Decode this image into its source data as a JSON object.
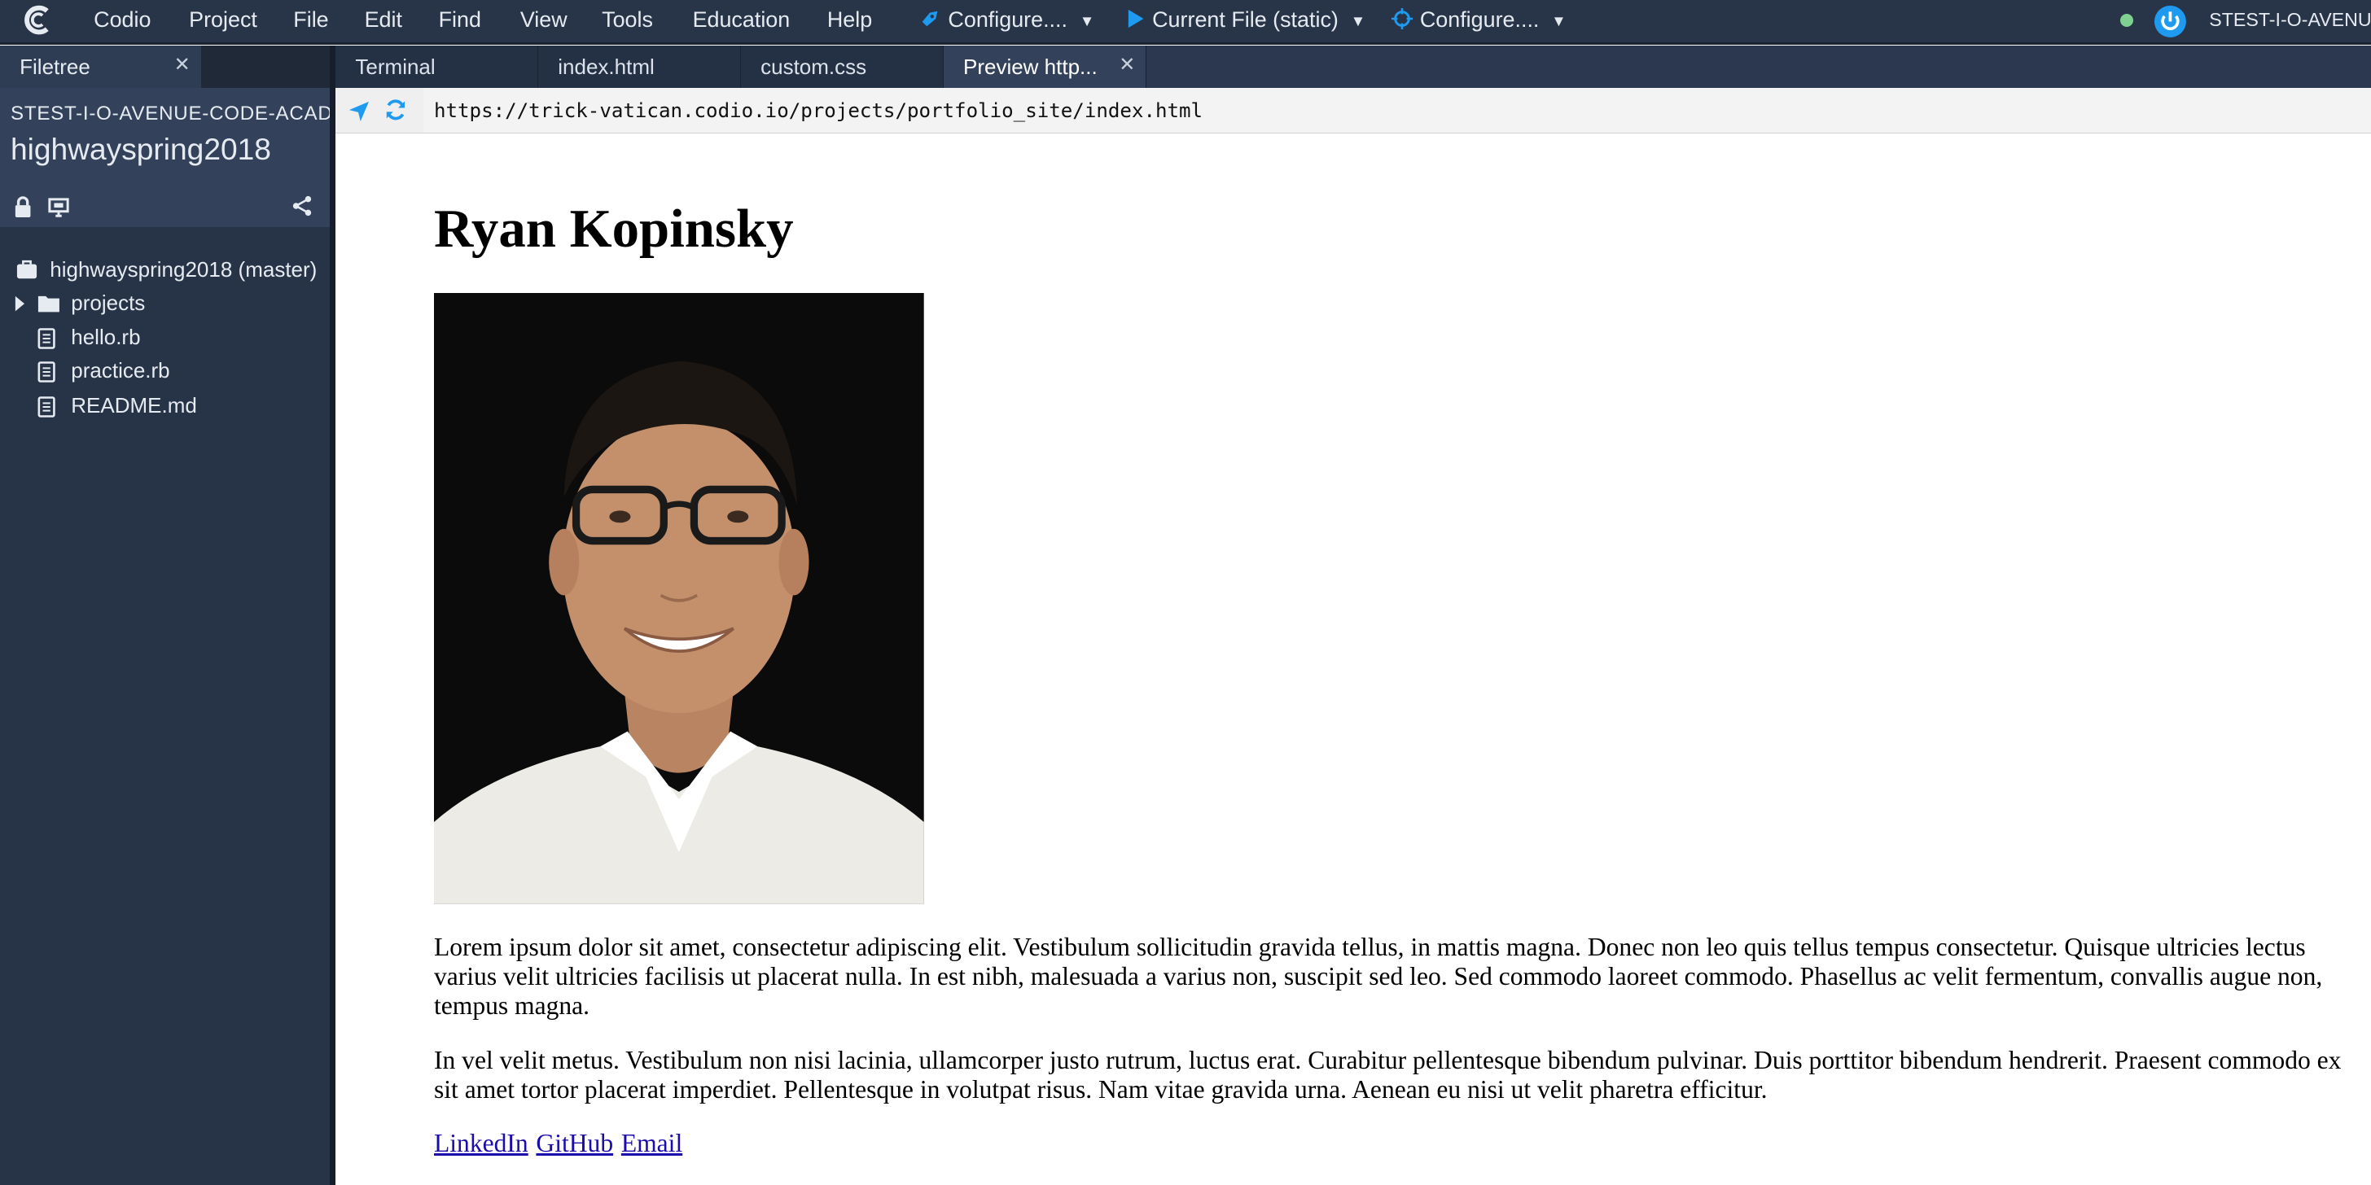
{
  "menu": {
    "items": [
      "Codio",
      "Project",
      "File",
      "Edit",
      "Find",
      "View",
      "Tools",
      "Education",
      "Help"
    ],
    "configure_deploy": "Configure....",
    "run_current": "Current File (static)",
    "configure_preview": "Configure....",
    "username": "STEST-I-O-AVENUE-C"
  },
  "sidebar": {
    "tab_label": "Filetree",
    "workspace": "STEST-I-O-AVENUE-CODE-ACADEMY",
    "project": "highwayspring2018",
    "tree": [
      {
        "label": "highwayspring2018 (master)",
        "icon": "briefcase-icon"
      },
      {
        "label": "projects",
        "icon": "folder-icon"
      },
      {
        "label": "hello.rb",
        "icon": "file-icon"
      },
      {
        "label": "practice.rb",
        "icon": "file-icon"
      },
      {
        "label": "README.md",
        "icon": "file-icon"
      }
    ]
  },
  "tabs": [
    "Terminal",
    "index.html",
    "custom.css",
    "Preview http..."
  ],
  "url": "https://trick-vatican.codio.io/projects/portfolio_site/index.html",
  "page": {
    "title": "Ryan Kopinsky",
    "para1": "Lorem ipsum dolor sit amet, consectetur adipiscing elit. Vestibulum sollicitudin gravida tellus, in mattis magna. Donec non leo quis tellus tempus consectetur. Quisque ultricies lectus varius velit ultricies facilisis ut placerat nulla. In est nibh, malesuada a varius non, suscipit sed leo. Sed commodo laoreet commodo. Phasellus ac velit fermentum, convallis augue non, tempus magna.",
    "para2": "In vel velit metus. Vestibulum non nisi lacinia, ullamcorper justo rutrum, luctus erat. Curabitur pellentesque bibendum pulvinar. Duis porttitor bibendum hendrerit. Praesent commodo ex sit amet tortor placerat imperdiet. Pellentesque in volutpat risus. Nam vitae gravida urna. Aenean eu nisi ut velit pharetra efficitur.",
    "links": [
      "LinkedIn",
      "GitHub",
      "Email"
    ]
  },
  "colors": {
    "menubar": "#283447",
    "sidebar": "#273346",
    "accent": "#1e9bf0",
    "status": "#7fd191"
  }
}
